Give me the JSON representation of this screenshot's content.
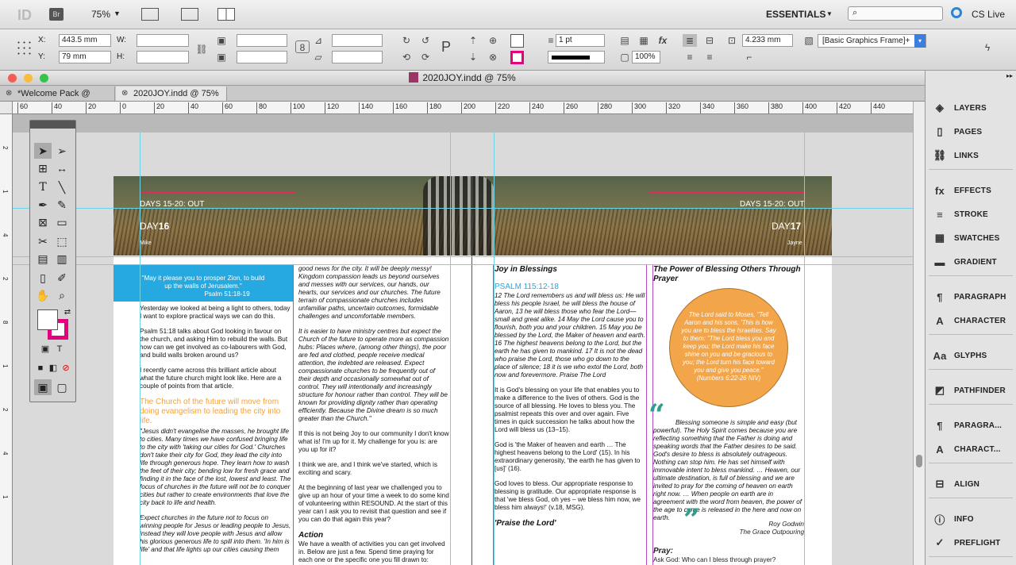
{
  "app": {
    "logo": "ID",
    "bridge": "Br",
    "zoom": "75%",
    "workspace": "ESSENTIALS",
    "search_placeholder": "",
    "cs_live": "CS Live"
  },
  "control": {
    "x_label": "X:",
    "x_value": "443.5 mm",
    "y_label": "Y:",
    "y_value": "79 mm",
    "w_label": "W:",
    "h_label": "H:",
    "stroke_weight": "1 pt",
    "scale": "100%",
    "dimension": "4.233 mm",
    "object_style": "[Basic Graphics Frame]+"
  },
  "document": {
    "window_title": "2020JOY.indd @ 75%",
    "tabs": [
      "*Welcome Pack @ 96%",
      "2020JOY.indd @ 75%"
    ]
  },
  "ruler": {
    "ticks": [
      "60",
      "40",
      "20",
      "0",
      "20",
      "40",
      "60",
      "80",
      "100",
      "120",
      "140",
      "160",
      "180",
      "200",
      "220",
      "240",
      "260",
      "280",
      "300",
      "320",
      "340",
      "360",
      "380",
      "400",
      "420",
      "440"
    ]
  },
  "panels": [
    "LAYERS",
    "PAGES",
    "LINKS",
    "EFFECTS",
    "STROKE",
    "SWATCHES",
    "GRADIENT",
    "PARAGRAPH",
    "CHARACTER",
    "GLYPHS",
    "PATHFINDER",
    "PARAGRA...",
    "CHARACT...",
    "ALIGN",
    "INFO",
    "PREFLIGHT"
  ],
  "spread": {
    "left_header": "DAYS 15-20: OUT",
    "left_day_prefix": "DAY",
    "left_day_num": "16",
    "left_author": "Mike",
    "right_header": "DAYS 15-20: OUT",
    "right_day_prefix": "DAY",
    "right_day_num": "17",
    "right_author": "Jayne",
    "quote_box": "\"May it please you to prosper Zion, to build up the walls of Jerusalem.\"",
    "quote_ref": "Psalm 51:18-19",
    "col1_p1": "Yesterday we looked at being a light to others, today I want to explore practical ways we can do this.",
    "col1_p2": "Psalm 51:18 talks about God looking in favour on the church, and asking Him to rebuild the walls. But how can we get involved as co-labourers with God, and build walls broken around us?",
    "col1_p3": "I recently came across this brilliant article about what the future church might look like. Here are a couple of points from that article.",
    "col1_heading": "The Church of the future will move from doing evangelism to leading the city into life.",
    "col1_p4": "\"Jesus didn't evangelise the masses, he brought life to cities. Many times we have confused bringing life to the city with 'taking our cities for God.' Churches don't take their city for God, they lead the city into life through generous hope. They learn how to wash the feet of their city; bending low for fresh grace and finding it in the face of the lost, lowest and least. The focus of churches in the future will not be to conquer cities but rather to create environments that love the city back to life and health.",
    "col1_p5": "Expect churches in the future not to focus on winning people for Jesus or leading people to Jesus, instead they will love people with Jesus and allow his glorious generous life to spill into them. 'In him is life' and that life lights up our cities causing them",
    "col2_p1": "good news for the city. It will be deeply messy! Kingdom compassion leads us beyond ourselves and messes with our services, our hands, our hearts, our services and our churches. The future terrain of compassionate churches includes unfamiliar paths, uncertain outcomes, formidable challenges and uncomfortable members.",
    "col2_p2": "It is easier to have ministry centres but expect the Church of the future to operate more as compassion hubs: Places where, (among other things), the poor are fed and clothed, people receive medical attention, the indebted are released. Expect compassionate churches to be frequently out of their depth and occasionally somewhat out of control. They will intentionally and increasingly structure for honour rather than control. They will be known for providing dignity rather than operating efficiently. Because the Divine dream is so much greater than the Church.\"",
    "col2_p3": "If this is not being Joy to our community I don't know what is! I'm up for it. My challenge for you is: are you up for it?",
    "col2_p4": "I think we are, and I think we've started, which is exciting and scary.",
    "col2_p5": "At the beginning of last year we challenged you to give up an hour of your time a week to do some kind of volunteering within RESOUND. At the start of this year can I ask you to revisit that question and see if you can do that again this year?",
    "col2_heading": "Action",
    "col2_p6": "We have a wealth of activities you can get involved in. Below are just a few. Spend time praying for each one or the specific one you fill drawn to:",
    "col3_title": "Joy in Blessings",
    "col3_psalm": "PSALM 115:12-18",
    "col3_verses": "12 The Lord remembers us and will bless us: He will bless his people Israel, he will bless the house of Aaron, 13 he will bless those who fear the Lord— small and great alike. 14 May the Lord cause you to flourish, both you and your children. 15 May you be blessed by the Lord, the Maker of heaven and earth. 16 The highest heavens belong to the Lord, but the earth he has given to mankind. 17 It is not the dead who praise the Lord, those who go down to the place of silence; 18 it is we who extol the Lord, both now and forevermore. Praise The Lord",
    "col3_p1": "It is God's blessing on your life that enables you to make a difference to the lives of others. God is the source of all blessing. He loves to bless you. The psalmist repeats this over and over again. Five times in quick succession he talks about how the Lord will bless us (13–15).",
    "col3_p2": "God is 'the Maker of heaven and earth … The highest heavens belong to the Lord' (15). In his extraordinary generosity, 'the earth he has given to [us]' (16).",
    "col3_p3": "God loves to bless. Our appropriate response to blessing is gratitude. Our appropriate response is that 'we bless God, oh yes – we bless him now, we bless him always!' (v.18, MSG).",
    "col3_heading2": "'Praise the Lord'",
    "col4_title": "The Power of Blessing Others Through Prayer",
    "circle_text": "The Lord said to Moses, \"Tell Aaron and his sons, 'This is how you are to bless the Israelites. Say to them: \"The Lord bless you and keep you; the Lord make his face shine on you and be gracious to you; the Lord turn his face toward you and give you peace.\"",
    "circle_ref": "(Numbers 6:22-26 NIV)",
    "col4_quote": "Blessing someone is simple and easy (but powerful). The Holy Spirit comes because you are reflecting something that the Father is doing and speaking words that the Father desires to be said. God's desire to bless is absolutely outrageous. Nothing can stop him. He has set himself with immovable intent to bless mankind. … Heaven, our ultimate destination, is full of blessing and we are invited to pray for the coming of heaven on earth right now. … When people on earth are in agreement with the word from heaven, the power of the age to come is released in the here and now on earth.",
    "col4_attr1": "Roy Godwin",
    "col4_attr2": "The Grace Outpouring",
    "col4_pray": "Pray:",
    "col4_pray_text": "Ask God: Who can I bless through prayer?"
  }
}
